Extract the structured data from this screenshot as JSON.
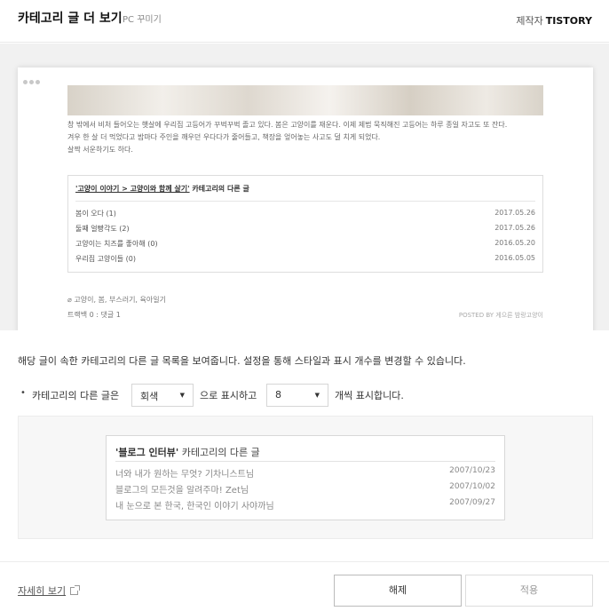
{
  "header": {
    "title": "카테고리 글 더 보기",
    "subtitle": "PC 꾸미기",
    "maker_label": "제작자",
    "maker_name": "TISTORY"
  },
  "preview": {
    "body_lines": [
      "창 밖에서 비처 들어오는 햇살에 우리집 고등어가 꾸벅꾸벅 졸고 있다. 봄은 고양이를 재운다. 이제 제법 묵직해진 고등어는 하루 종일 자고도 또 잔다.",
      "겨우 한 살 더 먹었다고 밤마다 주인을 깨우던 우다다가 줄어들고, 책장을 엎어놓는 사고도 덜 치게 되었다.",
      "살짝 서운하기도 하다."
    ],
    "related": {
      "path_link": "'고양이 이야기 > 고양이와 함께 살기'",
      "suffix": " 카테고리의 다른 글",
      "items": [
        {
          "title": "봄이 오다",
          "count": "(1)",
          "date": "2017.05.26"
        },
        {
          "title": "둘째 얼빵각도",
          "count": "(2)",
          "date": "2017.05.26"
        },
        {
          "title": "고양이는 치즈를 좋아해",
          "count": "(0)",
          "date": "2016.05.20"
        },
        {
          "title": "우리집 고양이들",
          "count": "(0)",
          "date": "2016.05.05"
        }
      ]
    },
    "tags": "고양이, 봄, 부스러기, 육아일기",
    "trackback": "트랙백 0 : 댓글 1",
    "posted_by": "POSTED BY 게으른 밤랑고양이"
  },
  "description": "해당 글이 속한 카테고리의 다른 글 목록을 보여줍니다. 설정을 통해 스타일과 표시 개수를 변경할 수 있습니다.",
  "options": {
    "bullet": "•",
    "prefix": "카테고리의 다른 글은",
    "style_value": "회색",
    "middle": "으로 표시하고",
    "count_value": "8",
    "suffix": "개씩 표시합니다."
  },
  "sample": {
    "title_quoted": "'블로그 인터뷰'",
    "title_suffix": " 카테고리의 다른 글",
    "items": [
      {
        "title": "너와 내가 원하는 무엇? 기차니스트님",
        "date": "2007/10/23"
      },
      {
        "title": "블로그의 모든것을 알려주마! Zet님",
        "date": "2007/10/02"
      },
      {
        "title": "내 눈으로 본 한국, 한국인 이야기 사야까님",
        "date": "2007/09/27"
      }
    ]
  },
  "footer": {
    "more_link": "자세히 보기",
    "cancel_label": "해제",
    "apply_label": "적용"
  }
}
